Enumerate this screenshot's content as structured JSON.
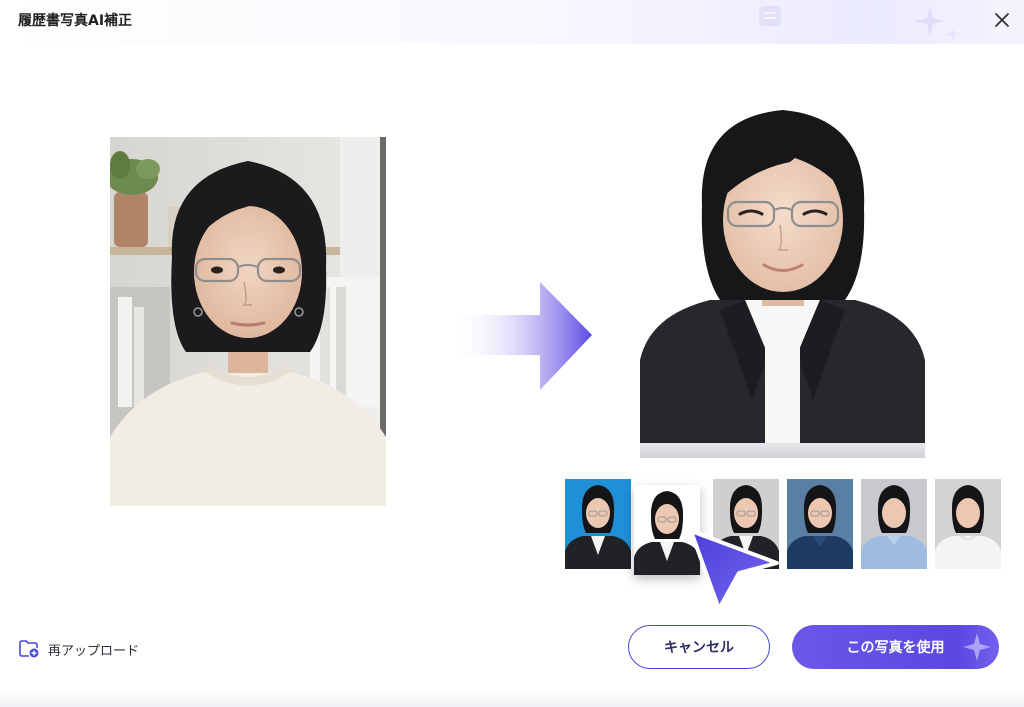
{
  "window": {
    "title": "履歴書写真AI補正"
  },
  "footer": {
    "reupload_label": "再アップロード",
    "cancel_label": "キャンセル",
    "use_label": "この写真を使用"
  },
  "thumbnails": [
    {
      "bg": "#1f8fd6",
      "outfit": "black-suit"
    },
    {
      "bg": "#ffffff",
      "outfit": "black-suit",
      "selected": true
    },
    {
      "bg": "#cfcfcf",
      "outfit": "black-suit"
    },
    {
      "bg": "#5a7fa4",
      "outfit": "navy-shirt"
    },
    {
      "bg": "#c7c9cc",
      "outfit": "light-blue-shirt"
    },
    {
      "bg": "#d3d3d3",
      "outfit": "white-shirt"
    }
  ],
  "colors": {
    "accent": "#5a48e0",
    "accent_light": "#8a7cf0",
    "text": "#1f2433"
  },
  "icons": [
    "close-icon",
    "folder-upload-icon",
    "sparkle-icon",
    "arrow-right-icon",
    "pointer-cursor-icon"
  ]
}
